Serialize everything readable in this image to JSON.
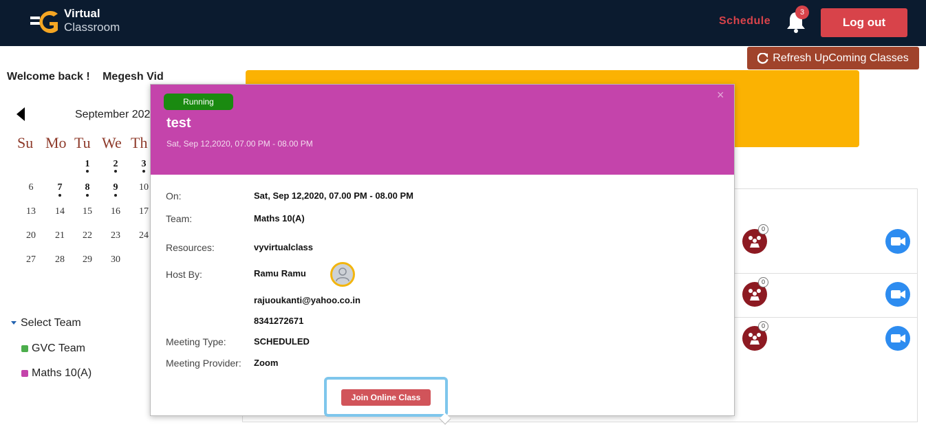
{
  "header": {
    "logo_title": "Virtual",
    "logo_subtitle": "Classroom",
    "schedule_label": "Schedule",
    "notification_count": "3",
    "logout_label": "Log out"
  },
  "refresh_label": "Refresh UpComing Classes",
  "welcome": {
    "greeting": "Welcome back !",
    "user": "Megesh Vid"
  },
  "calendar": {
    "month_label": "September 202",
    "weekday_headers": [
      "Su",
      "Mo",
      "Tu",
      "We",
      "Th"
    ],
    "days": [
      "1",
      "2",
      "3",
      "6",
      "7",
      "8",
      "9",
      "10",
      "13",
      "14",
      "15",
      "16",
      "17",
      "20",
      "21",
      "22",
      "23",
      "24",
      "27",
      "28",
      "29",
      "30"
    ]
  },
  "teams": {
    "heading": "Select Team",
    "items": [
      {
        "label": "GVC Team",
        "color": "#4cae4c"
      },
      {
        "label": "Maths 10(A)",
        "color": "#c444ab"
      }
    ]
  },
  "class_rows": [
    {
      "participants": "0"
    },
    {
      "participants": "0"
    },
    {
      "participants": "0"
    }
  ],
  "popup": {
    "status": "Running",
    "title": "test",
    "subtitle": "Sat, Sep 12,2020, 07.00 PM - 08.00 PM",
    "close_glyph": "×",
    "fields": {
      "on_label": "On:",
      "on_value": "Sat, Sep 12,2020, 07.00 PM - 08.00 PM",
      "team_label": "Team:",
      "team_value": "Maths 10(A)",
      "resources_label": "Resources:",
      "resources_value": "vyvirtualclass",
      "host_label": "Host By:",
      "host_name": "Ramu Ramu",
      "host_email": "rajuoukanti@yahoo.co.in",
      "host_phone": "8341272671",
      "type_label": "Meeting Type:",
      "type_value": "SCHEDULED",
      "provider_label": "Meeting Provider:",
      "provider_value": "Zoom"
    },
    "join_label": "Join Online Class"
  },
  "colors": {
    "topbar": "#0b1b2f",
    "accent_red": "#d8434a",
    "popup_header": "#c444ab",
    "banner_yellow": "#fbb202",
    "running_green": "#1a8a10"
  }
}
